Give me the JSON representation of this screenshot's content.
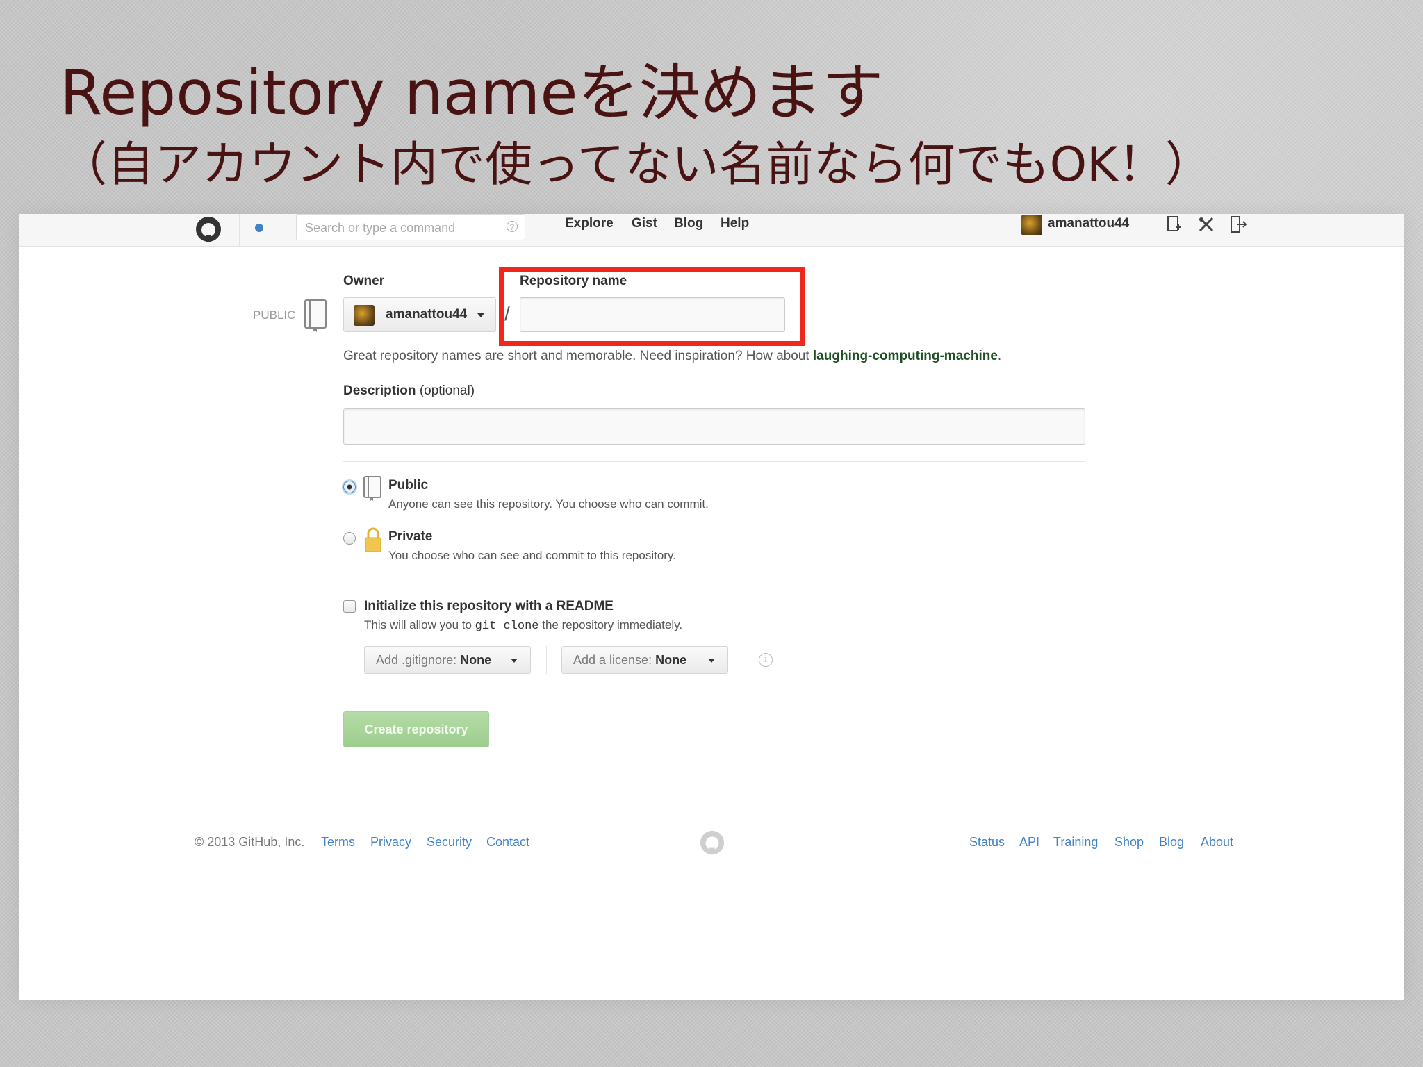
{
  "slide": {
    "title": "Repository nameを決めます",
    "subtitle": "（自アカウント内で使ってない名前なら何でもOK！）"
  },
  "header": {
    "search_placeholder": "Search or type a command",
    "search_help": "?",
    "nav": [
      "Explore",
      "Gist",
      "Blog",
      "Help"
    ],
    "username": "amanattou44"
  },
  "form": {
    "owner_label": "Owner",
    "repo_name_label": "Repository name",
    "public_tag": "PUBLIC",
    "owner_name": "amanattou44",
    "separator": "/",
    "repo_name_value": "",
    "hint_prefix": "Great repository names are short and memorable. Need inspiration? How about ",
    "hint_suggestion": "laughing-computing-machine",
    "hint_suffix": ".",
    "description_label": "Description",
    "description_optional": "(optional)",
    "description_value": "",
    "visibility": [
      {
        "title": "Public",
        "desc": "Anyone can see this repository. You choose who can commit.",
        "checked": true
      },
      {
        "title": "Private",
        "desc": "You choose who can see and commit to this repository.",
        "checked": false
      }
    ],
    "init_title": "Initialize this repository with a README",
    "init_desc_prefix": "This will allow you to ",
    "init_desc_code": "git clone",
    "init_desc_suffix": " the repository immediately.",
    "gitignore_label": "Add .gitignore:",
    "gitignore_value": "None",
    "license_label": "Add a license:",
    "license_value": "None",
    "info_glyph": "i",
    "create_button": "Create repository"
  },
  "footer": {
    "copyright": "© 2013 GitHub, Inc.",
    "left_links": [
      "Terms",
      "Privacy",
      "Security",
      "Contact"
    ],
    "right_links": [
      "Status",
      "API",
      "Training",
      "Shop",
      "Blog",
      "About"
    ]
  },
  "colors": {
    "title_text": "#4a1313",
    "highlight_border": "#f2271c",
    "link": "#4183c4",
    "create_button": "#9ccd8e"
  },
  "icons": [
    "github-octocat-icon",
    "notification-dot-icon",
    "help-icon",
    "create-new-icon",
    "settings-tools-icon",
    "sign-out-icon",
    "repo-book-icon",
    "lock-icon",
    "info-icon",
    "caret-down-icon"
  ]
}
